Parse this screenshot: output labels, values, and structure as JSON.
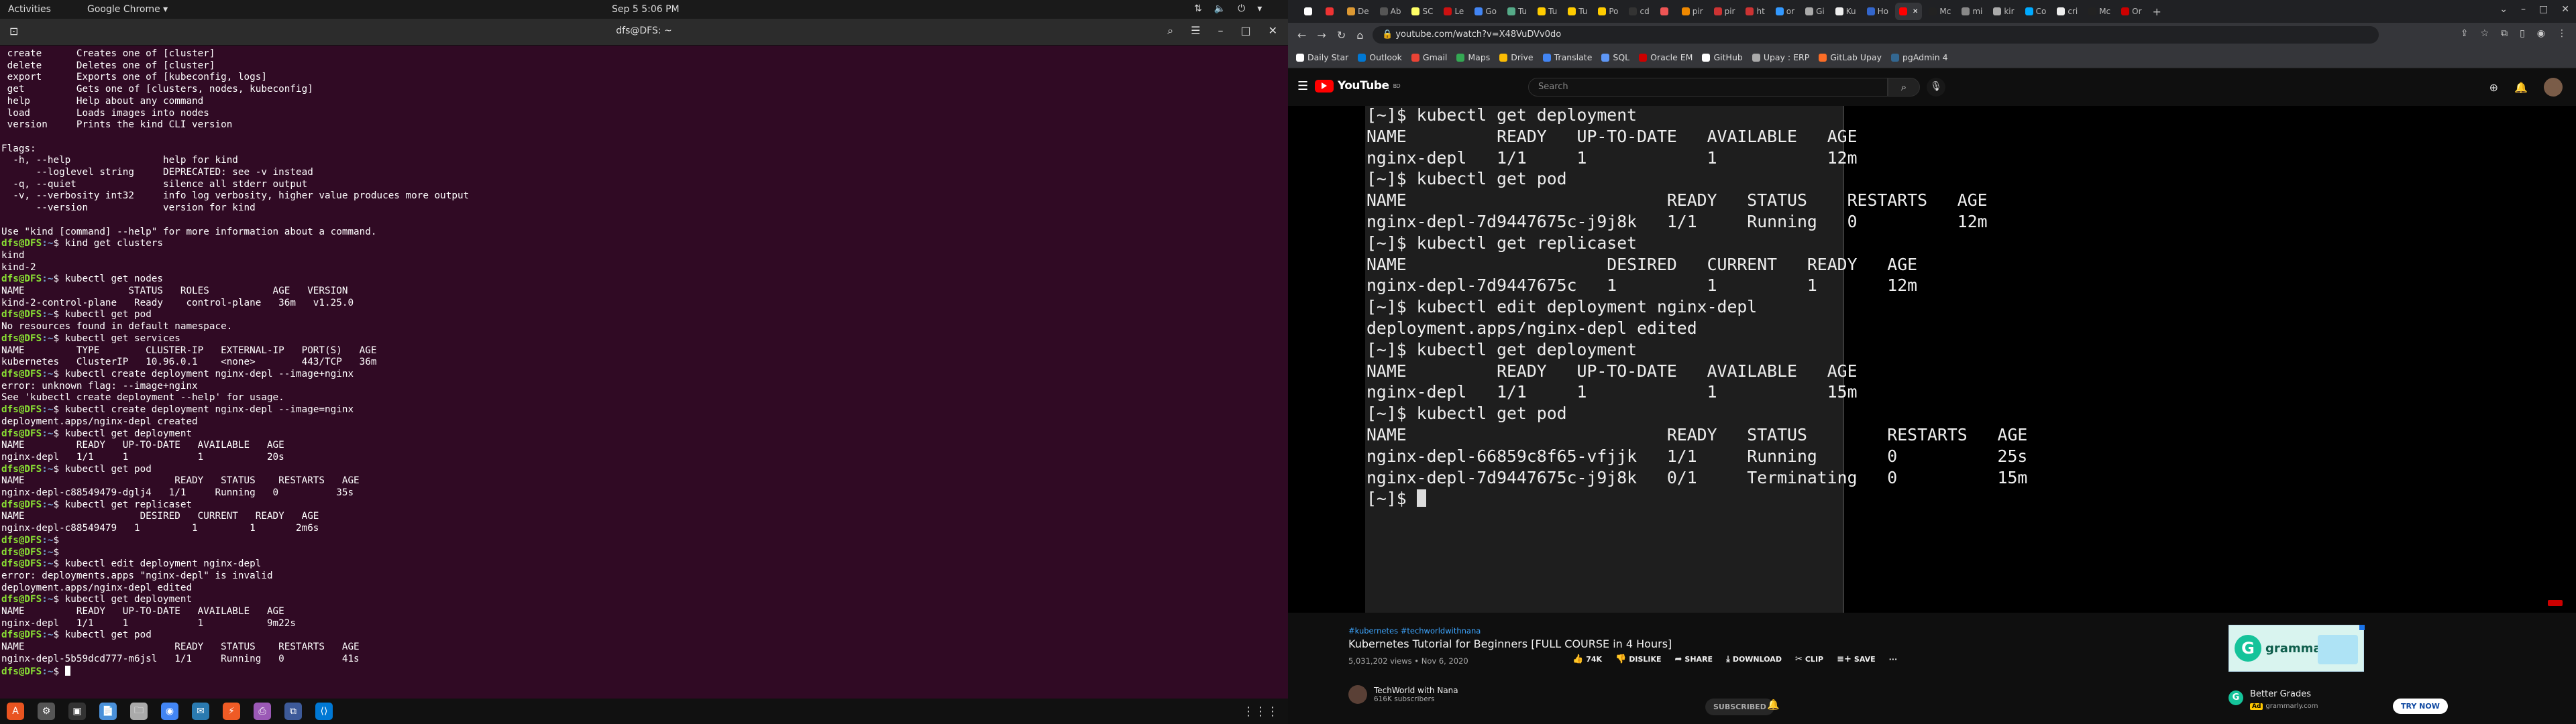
{
  "topbar": {
    "activities": "Activities",
    "app": "Google Chrome ▾",
    "clock": "Sep 5  5:06 PM"
  },
  "terminal": {
    "title": "dfs@DFS: ~",
    "lines": [
      [
        " create      Creates one of [cluster]",
        null
      ],
      [
        " delete      Deletes one of [cluster]",
        null
      ],
      [
        " export      Exports one of [kubeconfig, logs]",
        null
      ],
      [
        " get         Gets one of [clusters, nodes, kubeconfig]",
        null
      ],
      [
        " help        Help about any command",
        null
      ],
      [
        " load        Loads images into nodes",
        null
      ],
      [
        " version     Prints the kind CLI version",
        null
      ],
      [
        "",
        null
      ],
      [
        "Flags:",
        null
      ],
      [
        "  -h, --help                help for kind",
        null
      ],
      [
        "      --loglevel string     DEPRECATED: see -v instead",
        null
      ],
      [
        "  -q, --quiet               silence all stderr output",
        null
      ],
      [
        "  -v, --verbosity int32     info log verbosity, higher value produces more output",
        null
      ],
      [
        "      --version             version for kind",
        null
      ],
      [
        "",
        null
      ],
      [
        "Use \"kind [command] --help\" for more information about a command.",
        null
      ],
      [
        "",
        "kind get clusters"
      ],
      [
        "kind",
        null
      ],
      [
        "kind-2",
        null
      ],
      [
        "",
        "kubectl get nodes"
      ],
      [
        "NAME                  STATUS   ROLES           AGE   VERSION",
        null
      ],
      [
        "kind-2-control-plane   Ready    control-plane   36m   v1.25.0",
        null
      ],
      [
        "",
        "kubectl get pod"
      ],
      [
        "No resources found in default namespace.",
        null
      ],
      [
        "",
        "kubectl get services"
      ],
      [
        "NAME         TYPE        CLUSTER-IP   EXTERNAL-IP   PORT(S)   AGE",
        null
      ],
      [
        "kubernetes   ClusterIP   10.96.0.1    <none>        443/TCP   36m",
        null
      ],
      [
        "",
        "kubectl create deployment nginx-depl --image+nginx"
      ],
      [
        "error: unknown flag: --image+nginx",
        null
      ],
      [
        "See 'kubectl create deployment --help' for usage.",
        null
      ],
      [
        "",
        "kubectl create deployment nginx-depl --image=nginx"
      ],
      [
        "deployment.apps/nginx-depl created",
        null
      ],
      [
        "",
        "kubectl get deployment"
      ],
      [
        "NAME         READY   UP-TO-DATE   AVAILABLE   AGE",
        null
      ],
      [
        "nginx-depl   1/1     1            1           20s",
        null
      ],
      [
        "",
        "kubectl get pod"
      ],
      [
        "NAME                          READY   STATUS    RESTARTS   AGE",
        null
      ],
      [
        "nginx-depl-c88549479-dglj4   1/1     Running   0          35s",
        null
      ],
      [
        "",
        "kubectl get replicaset"
      ],
      [
        "NAME                    DESIRED   CURRENT   READY   AGE",
        null
      ],
      [
        "nginx-depl-c88549479   1         1         1       2m6s",
        null
      ],
      [
        "",
        ""
      ],
      [
        "",
        ""
      ],
      [
        "",
        "kubectl edit deployment nginx-depl"
      ],
      [
        "error: deployments.apps \"nginx-depl\" is invalid",
        null
      ],
      [
        "deployment.apps/nginx-depl edited",
        null
      ],
      [
        "",
        "kubectl get deployment"
      ],
      [
        "NAME         READY   UP-TO-DATE   AVAILABLE   AGE",
        null
      ],
      [
        "nginx-depl   1/1     1            1           9m22s",
        null
      ],
      [
        "",
        "kubectl get pod"
      ],
      [
        "NAME                          READY   STATUS    RESTARTS   AGE",
        null
      ],
      [
        "nginx-depl-5b59dcd777-m6jsl   1/1     Running   0          41s",
        null
      ],
      [
        "",
        ""
      ]
    ],
    "prompt_user": "dfs@DFS",
    "prompt_path": ":~",
    "prompt_end": "$ "
  },
  "dock": [
    "Ubuntu Software",
    "Settings",
    "Files",
    "Documents",
    "Files Manager",
    "Chrome",
    "Thunderbird",
    "Postman",
    "Screenshot",
    "Remmina",
    "VS Code"
  ],
  "chrome": {
    "tabs": [
      "",
      "",
      "De",
      "Ab",
      "SC",
      "Le",
      "Go",
      "Tu",
      "Tu",
      "Tu",
      "Po",
      "cd",
      "",
      "pir",
      "pir",
      "ht",
      "or",
      "Gi",
      "Ku",
      "Ho",
      "",
      "Mc",
      "mi",
      "kir",
      "Co",
      "cri",
      "Mc",
      "Or"
    ],
    "active_tab_index": 20,
    "url": "youtube.com/watch?v=X48VuDVv0do",
    "bookmarks": [
      "Daily Star",
      "Outlook",
      "Gmail",
      "Maps",
      "Drive",
      "Translate",
      "SQL",
      "Oracle EM",
      "GitHub",
      "Upay : ERP",
      "GitLab Upay",
      "pgAdmin 4"
    ]
  },
  "youtube": {
    "search_placeholder": "Search",
    "logo": "YouTube",
    "logo_country": "BD",
    "video_terminal": [
      [
        "[~]$ ",
        "kubectl get deployment"
      ],
      [
        "NAME         READY   UP-TO-DATE   AVAILABLE   AGE",
        null
      ],
      [
        "nginx-depl   1/1     1            1           12m",
        null
      ],
      [
        "[~]$ ",
        "kubectl get pod"
      ],
      [
        "NAME                          READY   STATUS    RESTARTS   AGE",
        null
      ],
      [
        "nginx-depl-7d9447675c-j9j8k   1/1     Running   0          12m",
        null
      ],
      [
        "[~]$ ",
        "kubectl get replicaset"
      ],
      [
        "NAME                    DESIRED   CURRENT   READY   AGE",
        null
      ],
      [
        "nginx-depl-7d9447675c   1         1         1       12m",
        null
      ],
      [
        "[~]$ ",
        "kubectl edit deployment nginx-depl"
      ],
      [
        "deployment.apps/nginx-depl edited",
        null
      ],
      [
        "[~]$ ",
        "kubectl get deployment"
      ],
      [
        "NAME         READY   UP-TO-DATE   AVAILABLE   AGE",
        null
      ],
      [
        "nginx-depl   1/1     1            1           15m",
        null
      ],
      [
        "[~]$ ",
        "kubectl get pod"
      ],
      [
        "NAME                          READY   STATUS        RESTARTS   AGE",
        null
      ],
      [
        "nginx-depl-66859c8f65-vfjjk   1/1     Running       0          25s",
        null
      ],
      [
        "nginx-depl-7d9447675c-j9j8k   0/1     Terminating   0          15m",
        null
      ],
      [
        "[~]$ ",
        ""
      ]
    ],
    "tags": "#kubernetes #techworldwithnana",
    "title": "Kubernetes Tutorial for Beginners [FULL COURSE in 4 Hours]",
    "meta": "5,031,202 views • Nov 6, 2020",
    "likes": "74K",
    "dislike": "DISLIKE",
    "share": "SHARE",
    "download": "DOWNLOAD",
    "clip": "CLIP",
    "save": "SAVE",
    "more": "···",
    "channel": "TechWorld with Nana",
    "subs": "616K subscribers",
    "subscribed": "SUBSCRIBED",
    "ad_brand": "grammarly",
    "ad_title": "Better Grades",
    "ad_badge": "Ad",
    "ad_domain": "grammarly.com",
    "ad_cta": "TRY NOW"
  },
  "colors": {
    "terminal_bg": "#300a24",
    "prompt": "#8ae234",
    "path": "#729fcf",
    "yt_red": "#ff0000"
  }
}
